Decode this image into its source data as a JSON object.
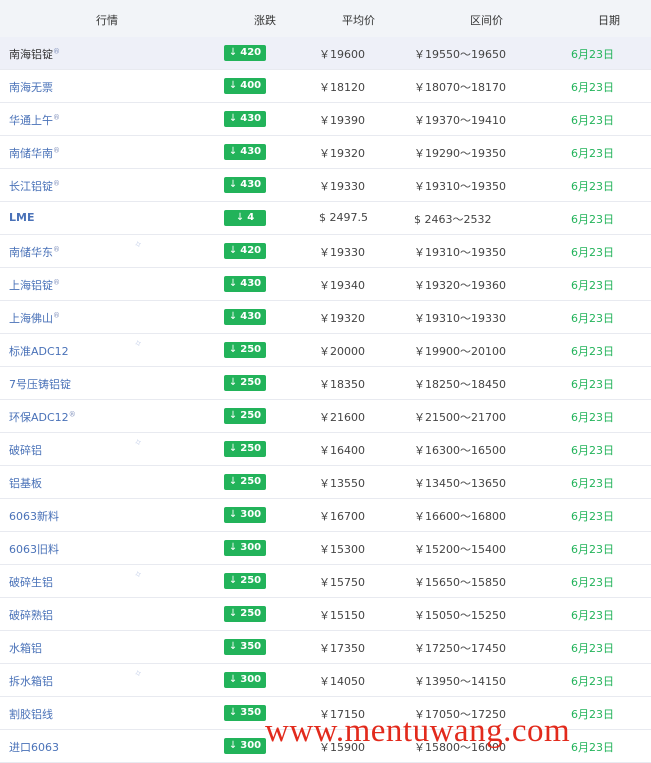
{
  "header": {
    "col_market": "行情",
    "col_change": "涨跌",
    "col_avg": "平均价",
    "col_range": "区间价",
    "col_date": "日期"
  },
  "rows": [
    {
      "name": "南海铝锭",
      "change": "420",
      "avg": "￥19600",
      "range": "￥19550～19650",
      "date": "6月23日"
    },
    {
      "name": "南海无票",
      "change": "400",
      "avg": "￥18120",
      "range": "￥18070～18170",
      "date": "6月23日"
    },
    {
      "name": "华通上午",
      "change": "430",
      "avg": "￥19390",
      "range": "￥19370～19410",
      "date": "6月23日"
    },
    {
      "name": "南储华南",
      "change": "430",
      "avg": "￥19320",
      "range": "￥19290～19350",
      "date": "6月23日"
    },
    {
      "name": "长江铝锭",
      "change": "430",
      "avg": "￥19330",
      "range": "￥19310～19350",
      "date": "6月23日"
    },
    {
      "name": "LME",
      "change": "4",
      "avg": "$ 2497.5",
      "range": "$ 2463～2532",
      "date": "6月23日"
    },
    {
      "name": "南储华东",
      "change": "420",
      "avg": "￥19330",
      "range": "￥19310～19350",
      "date": "6月23日"
    },
    {
      "name": "上海铝锭",
      "change": "430",
      "avg": "￥19340",
      "range": "￥19320～19360",
      "date": "6月23日"
    },
    {
      "name": "上海佛山",
      "change": "430",
      "avg": "￥19320",
      "range": "￥19310～19330",
      "date": "6月23日"
    },
    {
      "name": "标准ADC12",
      "change": "250",
      "avg": "￥20000",
      "range": "￥19900～20100",
      "date": "6月23日"
    },
    {
      "name": "7号压铸铝锭",
      "change": "250",
      "avg": "￥18350",
      "range": "￥18250～18450",
      "date": "6月23日"
    },
    {
      "name": "环保ADC12",
      "change": "250",
      "avg": "￥21600",
      "range": "￥21500～21700",
      "date": "6月23日"
    },
    {
      "name": "破碎铝",
      "change": "250",
      "avg": "￥16400",
      "range": "￥16300～16500",
      "date": "6月23日"
    },
    {
      "name": "铝基板",
      "change": "250",
      "avg": "￥13550",
      "range": "￥13450～13650",
      "date": "6月23日"
    },
    {
      "name": "6063新料",
      "change": "300",
      "avg": "￥16700",
      "range": "￥16600～16800",
      "date": "6月23日"
    },
    {
      "name": "6063旧料",
      "change": "300",
      "avg": "￥15300",
      "range": "￥15200～15400",
      "date": "6月23日"
    },
    {
      "name": "破碎生铝",
      "change": "250",
      "avg": "￥15750",
      "range": "￥15650～15850",
      "date": "6月23日"
    },
    {
      "name": "破碎熟铝",
      "change": "250",
      "avg": "￥15150",
      "range": "￥15050～15250",
      "date": "6月23日"
    },
    {
      "name": "水箱铝",
      "change": "350",
      "avg": "￥17350",
      "range": "￥17250～17450",
      "date": "6月23日"
    },
    {
      "name": "拆水箱铝",
      "change": "300",
      "avg": "￥14050",
      "range": "￥13950～14150",
      "date": "6月23日"
    },
    {
      "name": "割胶铝线",
      "change": "350",
      "avg": "￥17150",
      "range": "￥17050～17250",
      "date": "6月23日"
    },
    {
      "name": "进口6063",
      "change": "300",
      "avg": "￥15900",
      "range": "￥15800～16000",
      "date": "6月23日"
    }
  ],
  "badge_arrow": "↓",
  "watermark_text": "www.mentuwang.com",
  "colors": {
    "badge": "#22b35a",
    "link": "#4a72b8",
    "date": "#22b35a",
    "watermark": "#e22a1c"
  }
}
